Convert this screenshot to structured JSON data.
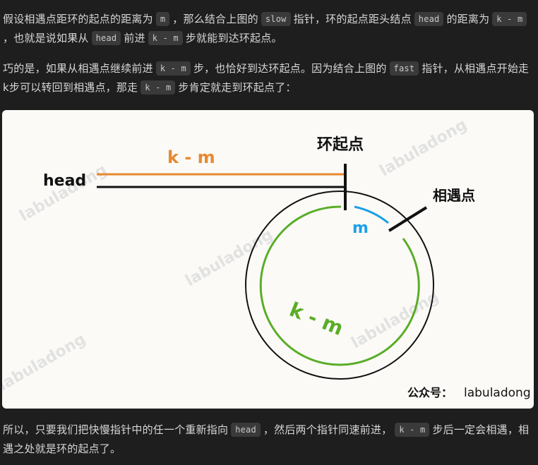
{
  "paragraph1": {
    "t1": "假设相遇点距环的起点的距离为",
    "c1": "m",
    "t2": "，那么结合上图的",
    "c2": "slow",
    "t3": "指针，环的起点距头结点",
    "c3": "head",
    "t4": "的距离为",
    "c4": "k - m",
    "t5": "，也就是说如果从",
    "c5": "head",
    "t6": "前进",
    "c6": "k - m",
    "t7": "步就能到达环起点。"
  },
  "paragraph2": {
    "t1": "巧的是，如果从相遇点继续前进",
    "c1": "k - m",
    "t2": "步，也恰好到达环起点。因为结合上图的",
    "c2": "fast",
    "t3": "指针，从相遇点开始走k步可以转回到相遇点，那走",
    "c3": "k - m",
    "t4": "步肯定就走到环起点了："
  },
  "figure": {
    "label_head": "head",
    "label_k_minus_m_top": "k - m",
    "label_loop_start": "环起点",
    "label_meet_point": "相遇点",
    "label_m": "m",
    "label_k_minus_m_arc": "k - m",
    "watermark": "labuladong",
    "signature_prefix": "公众号：",
    "signature_name": "labuladong",
    "colors": {
      "orange": "#e8892f",
      "green": "#5aad27",
      "blue": "#1ea0e6",
      "black": "#111111"
    }
  },
  "paragraph3": {
    "t1": "所以，只要我们把快慢指针中的任一个重新指向",
    "c1": "head",
    "t2": "，然后两个指针同速前进，",
    "c2": "k - m",
    "t3": "步后一定会相遇，相遇之处就是环的起点了。"
  }
}
